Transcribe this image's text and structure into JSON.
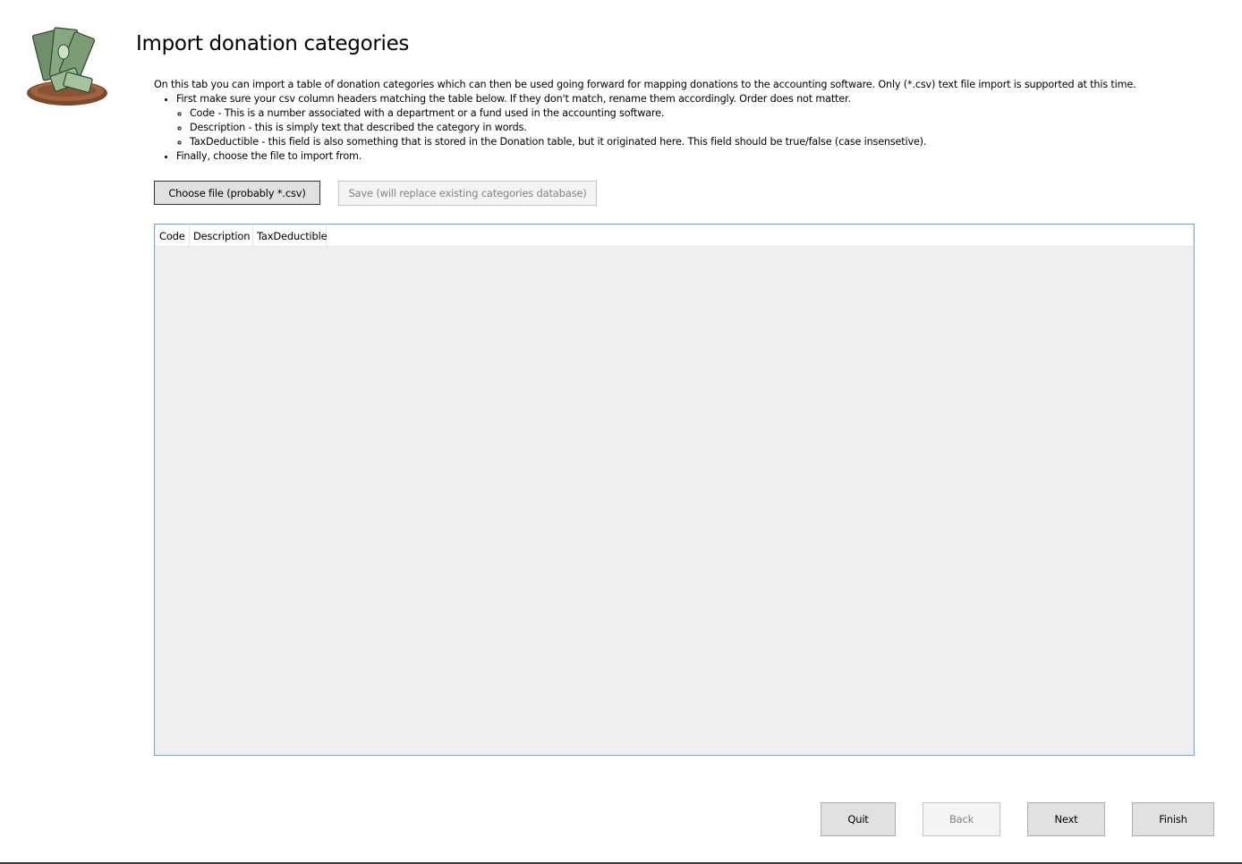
{
  "page": {
    "title": "Import donation categories"
  },
  "logo": {
    "icon": "money-bowl-icon"
  },
  "instructions": {
    "intro": "On this tab you can import a table of donation categories which can then be used going forward for mapping donations to the accounting software. Only (*.csv) text file import is supported at this time.",
    "step1": "First make sure your csv column headers matching the table below. If they don't match, rename them accordingly. Order does not matter.",
    "sub": [
      "Code - This is a number associated with a department or a fund used in the accounting software.",
      "Description - this is simply text that described the category in words.",
      "TaxDeductible - this field is also something that is stored in the Donation table, but it originated here. This field should be true/false (case insensetive)."
    ],
    "step2": "Finally, choose the file to import from."
  },
  "toolbar": {
    "choose_label": "Choose file (probably *.csv)",
    "save_label": "Save (will replace existing categories database)"
  },
  "table": {
    "columns": [
      "Code",
      "Description",
      "TaxDeductible"
    ]
  },
  "footer": {
    "quit_label": "Quit",
    "back_label": "Back",
    "next_label": "Next",
    "finish_label": "Finish"
  },
  "colors": {
    "grid_background": "#efefef",
    "grid_border": "#8aa3b8",
    "button_face": "#e1e1e1"
  }
}
